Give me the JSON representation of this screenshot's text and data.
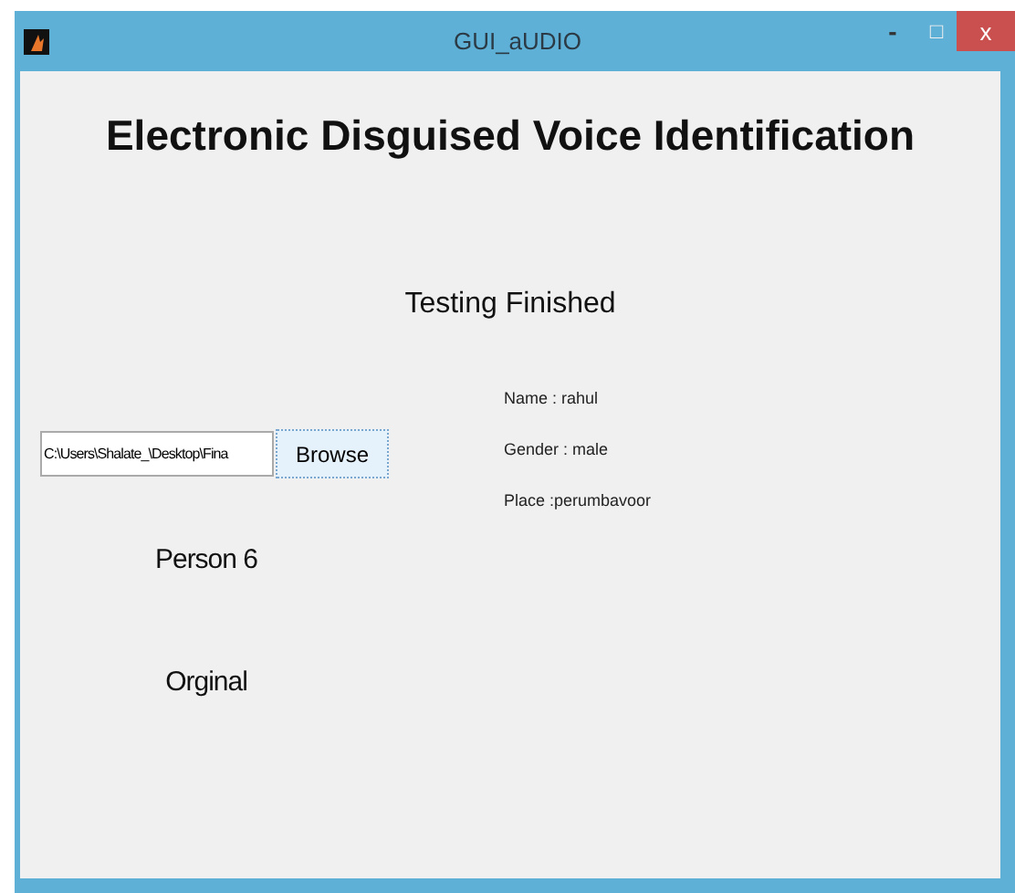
{
  "window": {
    "title": "GUI_aUDIO",
    "controls": [
      "-",
      "□",
      "x"
    ]
  },
  "heading": "Electronic Disguised Voice Identification",
  "status": "Testing Finished",
  "file_field": {
    "value": "C:\\Users\\Shalate_\\Desktop\\Fina"
  },
  "browse_button": "Browse",
  "details": [
    "Name : rahul",
    "Gender : male",
    "Place :perumbavoor"
  ],
  "person": "Person 6",
  "result": "Orginal"
}
